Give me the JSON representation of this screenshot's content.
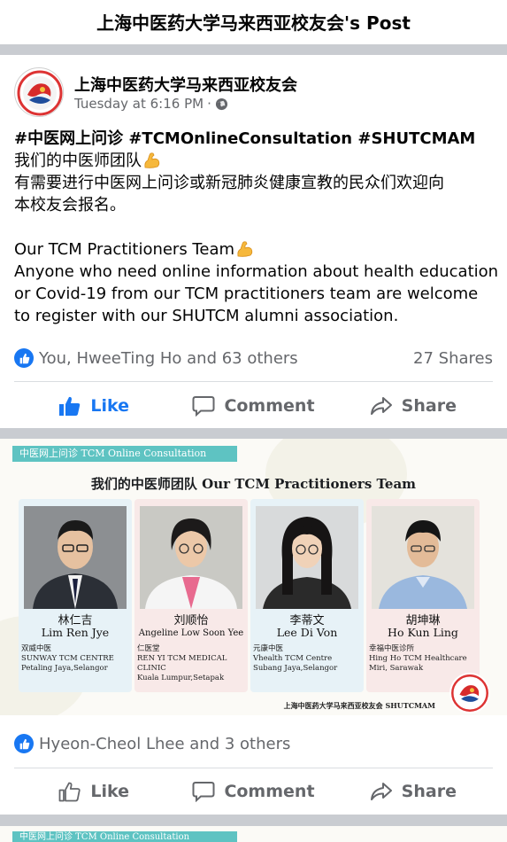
{
  "header": {
    "title": "上海中医药大学马来西亚校友会's Post"
  },
  "post": {
    "page_name": "上海中医药大学马来西亚校友会",
    "time": "Tuesday at 6:16 PM",
    "separator": "·",
    "privacy_icon": "globe-icon",
    "avatar_icon": "alumni-logo",
    "hashtags": "#中医网上问诊 #TCMOnlineConsultation #SHUTCMAM",
    "cn_line1": "我们的中医师团队",
    "cn_line2": "有需要进行中医网上问诊或新冠肺炎健康宣教的民众们欢迎向",
    "cn_line3": "本校友会报名。",
    "en_line1": "Our TCM Practitioners Team",
    "en_line2": "Anyone who need online information about health education",
    "en_line3": "or Covid-19 from our TCM practitioners team are welcome",
    "en_line4": "to register with our SHUTCM alumni association.",
    "emoji_icon": "flexed-biceps-icon",
    "reactions": "You, HweeTing Ho and 63 others",
    "shares": "27 Shares",
    "liked": true
  },
  "actions": {
    "like": "Like",
    "comment": "Comment",
    "share": "Share"
  },
  "photo": {
    "banner": "中医网上问诊 TCM Online Consultation",
    "title": "我们的中医师团队 Our TCM Practitioners Team",
    "practitioners": [
      {
        "cn": "林仁吉",
        "en": "Lim Ren Jye",
        "d1": "双威中医",
        "d2": "SUNWAY TCM CENTRE",
        "d3": "Petaling Jaya,Selangor",
        "d4": ""
      },
      {
        "cn": "刘顺怡",
        "en": "Angeline Low Soon Yee",
        "d1": "仁医堂",
        "d2": "REN YI TCM MEDICAL",
        "d3": "CLINIC",
        "d4": "Kuala Lumpur,Setapak"
      },
      {
        "cn": "李蒂文",
        "en": "Lee Di Von",
        "d1": "元康中医",
        "d2": "Vhealth TCM Centre",
        "d3": "Subang Jaya,Selangor",
        "d4": ""
      },
      {
        "cn": "胡坤琳",
        "en": "Ho Kun Ling",
        "d1": "幸福中医诊所",
        "d2": "Hing Ho TCM Healthcare",
        "d3": "Miri, Sarawak",
        "d4": ""
      }
    ],
    "footer": "上海中医药大学马来西亚校友会 SHUTCMAM",
    "reactions": "Hyeon-Cheol Lhee and 3 others",
    "liked": false
  },
  "next_photo": {
    "banner": "中医网上问诊 TCM Online Consultation"
  },
  "colors": {
    "facebook_blue": "#1877f2",
    "secondary_text": "#65676b",
    "banner_teal": "#5ec3c2",
    "divider": "#c9ccd1"
  }
}
